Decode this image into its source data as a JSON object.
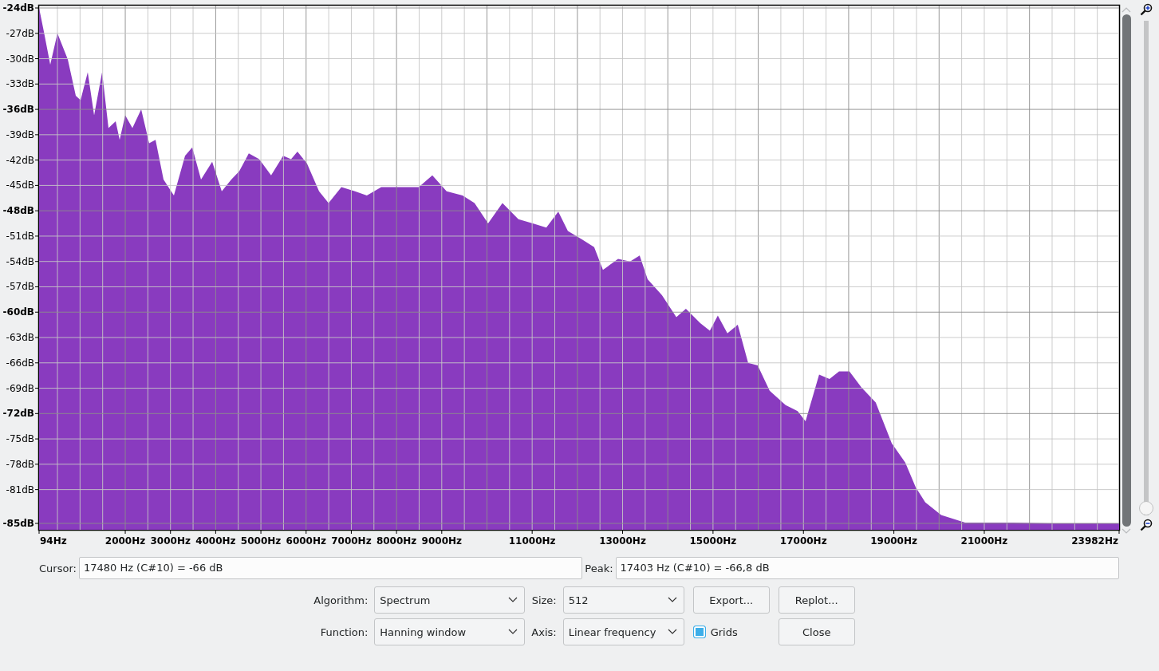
{
  "chart_data": {
    "type": "area",
    "grid": true,
    "xlim": [
      94,
      23982
    ],
    "ylim": [
      -85,
      -24
    ],
    "xticks": [
      {
        "value": 94,
        "label": "94Hz"
      },
      {
        "value": 2000,
        "label": "2000Hz"
      },
      {
        "value": 3000,
        "label": "3000Hz"
      },
      {
        "value": 4000,
        "label": "4000Hz"
      },
      {
        "value": 5000,
        "label": "5000Hz"
      },
      {
        "value": 6000,
        "label": "6000Hz"
      },
      {
        "value": 7000,
        "label": "7000Hz"
      },
      {
        "value": 8000,
        "label": "8000Hz"
      },
      {
        "value": 9000,
        "label": "9000Hz"
      },
      {
        "value": 11000,
        "label": "11000Hz"
      },
      {
        "value": 13000,
        "label": "13000Hz"
      },
      {
        "value": 15000,
        "label": "15000Hz"
      },
      {
        "value": 17000,
        "label": "17000Hz"
      },
      {
        "value": 19000,
        "label": "19000Hz"
      },
      {
        "value": 21000,
        "label": "21000Hz"
      },
      {
        "value": 23982,
        "label": "23982Hz"
      }
    ],
    "yticks": [
      {
        "value": -24,
        "label": "-24dB"
      },
      {
        "value": -27,
        "label": "-27dB"
      },
      {
        "value": -30,
        "label": "-30dB"
      },
      {
        "value": -33,
        "label": "-33dB"
      },
      {
        "value": -36,
        "label": "-36dB"
      },
      {
        "value": -39,
        "label": "-39dB"
      },
      {
        "value": -42,
        "label": "-42dB"
      },
      {
        "value": -45,
        "label": "-45dB"
      },
      {
        "value": -48,
        "label": "-48dB"
      },
      {
        "value": -51,
        "label": "-51dB"
      },
      {
        "value": -54,
        "label": "-54dB"
      },
      {
        "value": -57,
        "label": "-57dB"
      },
      {
        "value": -60,
        "label": "-60dB"
      },
      {
        "value": -63,
        "label": "-63dB"
      },
      {
        "value": -66,
        "label": "-66dB"
      },
      {
        "value": -69,
        "label": "-69dB"
      },
      {
        "value": -72,
        "label": "-72dB"
      },
      {
        "value": -75,
        "label": "-75dB"
      },
      {
        "value": -78,
        "label": "-78dB"
      },
      {
        "value": -81,
        "label": "-81dB"
      },
      {
        "value": -85,
        "label": "-85dB"
      }
    ],
    "x": [
      94,
      200,
      341,
      500,
      729,
      905,
      1011,
      1170,
      1311,
      1488,
      1629,
      1788,
      1876,
      2000,
      2158,
      2352,
      2528,
      2669,
      2846,
      3075,
      3322,
      3481,
      3675,
      3922,
      4134,
      4346,
      4522,
      4733,
      4963,
      5227,
      5492,
      5668,
      5809,
      6021,
      6286,
      6497,
      6780,
      7080,
      7344,
      7662,
      8050,
      8491,
      8791,
      9108,
      9461,
      9725,
      10025,
      10343,
      10696,
      11013,
      11313,
      11578,
      11789,
      12107,
      12372,
      12566,
      12901,
      13166,
      13377,
      13554,
      13871,
      14189,
      14400,
      14718,
      14930,
      15106,
      15318,
      15547,
      15777,
      15988,
      16253,
      16606,
      16870,
      17047,
      17347,
      17576,
      17788,
      18017,
      18282,
      18599,
      18952,
      19252,
      19481,
      19693,
      20046,
      20575,
      21634,
      22516,
      23400,
      23982
    ],
    "series": [
      {
        "color": "#893bbf",
        "values": [
          -24,
          -26.8,
          -30.7,
          -27,
          -30.1,
          -34.4,
          -34.9,
          -31.6,
          -36.7,
          -31.6,
          -38.2,
          -37.4,
          -39.6,
          -36.7,
          -38.2,
          -36,
          -40,
          -39.6,
          -44.3,
          -46.2,
          -41.5,
          -40.5,
          -44.3,
          -42.2,
          -45.7,
          -44.3,
          -43.3,
          -41.2,
          -41.9,
          -43.8,
          -41.5,
          -41.9,
          -41,
          -42.4,
          -45.7,
          -47.1,
          -45.2,
          -45.7,
          -46.2,
          -45.2,
          -45.2,
          -45.2,
          -43.8,
          -45.7,
          -46.2,
          -47.1,
          -49.5,
          -47.1,
          -49,
          -49.5,
          -50,
          -48.1,
          -50.4,
          -51.4,
          -52.3,
          -55,
          -53.7,
          -54,
          -53.3,
          -56.1,
          -58,
          -60.6,
          -59.6,
          -61.3,
          -62.2,
          -60.4,
          -62.5,
          -61.5,
          -66,
          -66.3,
          -69.3,
          -71,
          -71.7,
          -72.9,
          -67.4,
          -67.9,
          -67,
          -67,
          -68.9,
          -70.7,
          -75.5,
          -77.8,
          -80.7,
          -82.5,
          -84,
          -84.9,
          -84.9,
          -85,
          -85,
          -85
        ]
      }
    ]
  },
  "zoom_slider": {
    "level": 0
  },
  "cursor": {
    "label": "Cursor:",
    "value": "17480 Hz (C#10) = -66 dB"
  },
  "peak": {
    "label": "Peak:",
    "value": "17403 Hz (C#10) = -66,8 dB"
  },
  "algorithm": {
    "label": "Algorithm:",
    "value": "Spectrum"
  },
  "size": {
    "label": "Size:",
    "value": "512"
  },
  "function": {
    "label": "Function:",
    "value": "Hanning window"
  },
  "axis": {
    "label": "Axis:",
    "value": "Linear frequency"
  },
  "grids": {
    "label": "Grids",
    "checked": true
  },
  "buttons": [
    "Export...",
    "Replot...",
    "Close"
  ]
}
